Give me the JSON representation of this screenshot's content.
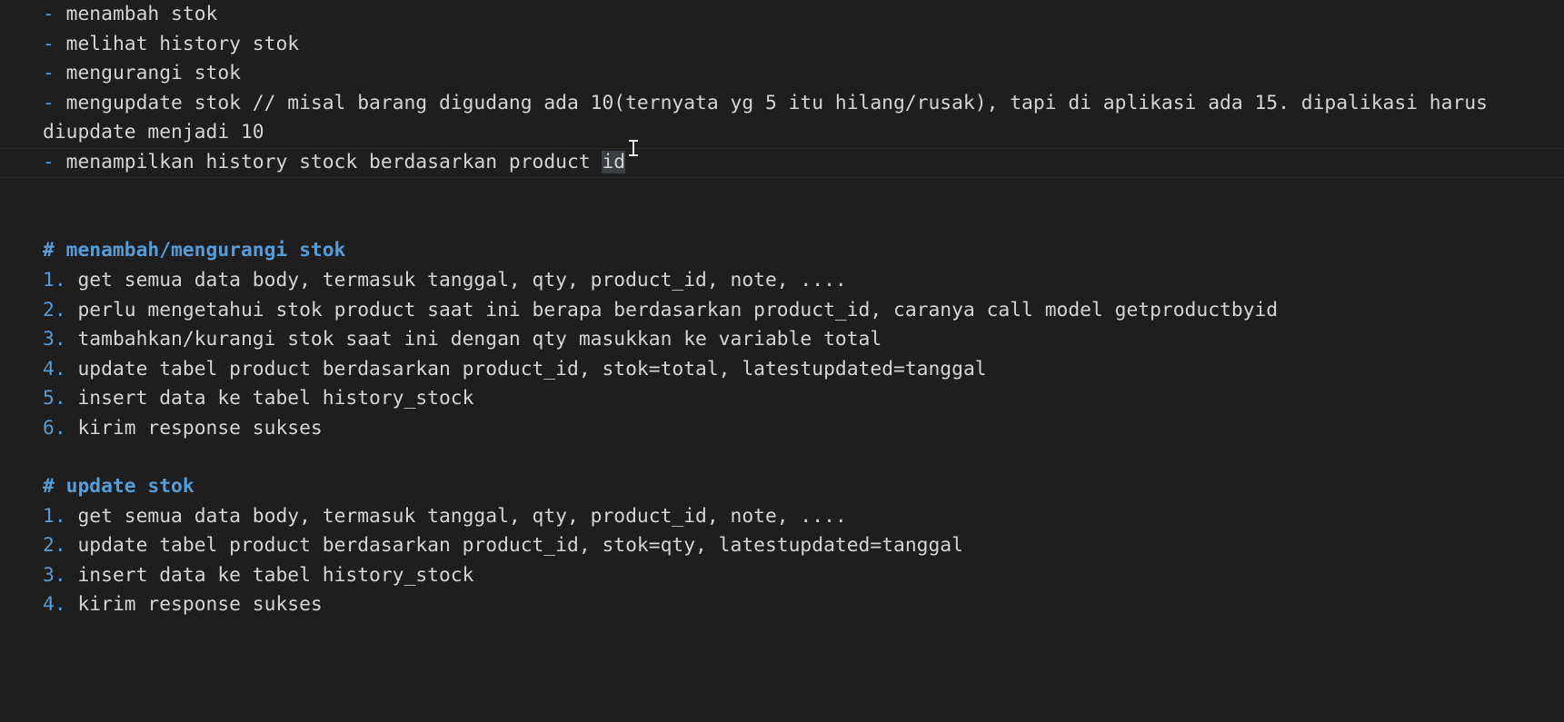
{
  "notes": {
    "bullets": [
      {
        "dash": "-",
        "text": "menambah stok"
      },
      {
        "dash": "-",
        "text": "melihat history stok"
      },
      {
        "dash": "-",
        "text": "mengurangi stok"
      },
      {
        "dash": "-",
        "text": "mengupdate stok // misal barang digudang ada 10(ternyata yg 5 itu hilang/rusak), tapi di aplikasi ada 15. dipalikasi harus"
      },
      {
        "dash": "",
        "text": "diupdate menjadi 10"
      },
      {
        "dash": "-",
        "text": "menampilkan history stock berdasarkan product ",
        "selected": "id"
      }
    ]
  },
  "section1": {
    "heading": "# menambah/mengurangi stok",
    "steps": [
      {
        "num": "1.",
        "text": "get semua data body, termasuk tanggal, qty, product_id, note, ...."
      },
      {
        "num": "2.",
        "text": "perlu mengetahui stok product saat ini berapa berdasarkan product_id, caranya call model getproductbyid"
      },
      {
        "num": "3.",
        "text": "tambahkan/kurangi stok saat ini dengan qty masukkan ke variable total"
      },
      {
        "num": "4.",
        "text": "update tabel product berdasarkan product_id, stok=total, latestupdated=tanggal"
      },
      {
        "num": "5.",
        "text": "insert data ke tabel history_stock"
      },
      {
        "num": "6.",
        "text": "kirim response sukses"
      }
    ]
  },
  "section2": {
    "heading": "# update stok",
    "steps": [
      {
        "num": "1.",
        "text": "get semua data body, termasuk tanggal, qty, product_id, note, ...."
      },
      {
        "num": "2.",
        "text": "update tabel product berdasarkan product_id, stok=qty, latestupdated=tanggal"
      },
      {
        "num": "3.",
        "text": "insert data ke tabel history_stock"
      },
      {
        "num": "4.",
        "text": "kirim response sukses"
      }
    ]
  },
  "colors": {
    "background": "#1e1e1e",
    "text": "#d4d4d4",
    "accent": "#569cd6"
  }
}
